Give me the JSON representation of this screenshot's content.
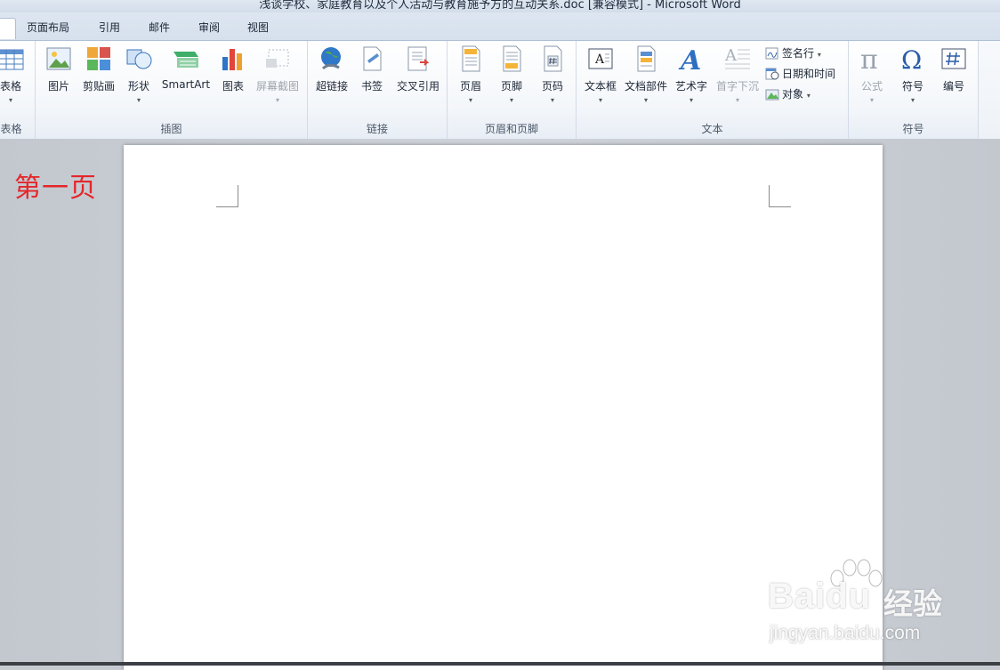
{
  "window": {
    "title": "浅谈学校、家庭教育以及个人活动与教育施予方的互动关系.doc [兼容模式] - Microsoft Word"
  },
  "tabs": [
    {
      "label": ""
    },
    {
      "label": "页面布局"
    },
    {
      "label": "引用"
    },
    {
      "label": "邮件"
    },
    {
      "label": "审阅"
    },
    {
      "label": "视图"
    }
  ],
  "groups": {
    "table": {
      "label": "表格",
      "button": "表格"
    },
    "illustrations": {
      "label": "插图",
      "buttons": [
        "图片",
        "剪贴画",
        "形状",
        "SmartArt",
        "图表",
        "屏幕截图"
      ]
    },
    "links": {
      "label": "链接",
      "buttons": [
        "超链接",
        "书签",
        "交叉引用"
      ]
    },
    "header_footer": {
      "label": "页眉和页脚",
      "buttons": [
        "页眉",
        "页脚",
        "页码"
      ]
    },
    "text": {
      "label": "文本",
      "buttons": [
        "文本框",
        "文档部件",
        "艺术字",
        "首字下沉"
      ],
      "small": [
        "签名行",
        "日期和时间",
        "对象"
      ]
    },
    "symbols": {
      "label": "符号",
      "buttons": [
        "公式",
        "符号",
        "编号"
      ]
    }
  },
  "dropdown_glyph": "▾",
  "annotation": "第一页",
  "watermark": {
    "word": "Baidu",
    "cn": "经验",
    "url": "jingyan.baidu.com"
  },
  "colors": {
    "annotation": "#e4262a",
    "ribbon_border": "#aebfd6"
  }
}
